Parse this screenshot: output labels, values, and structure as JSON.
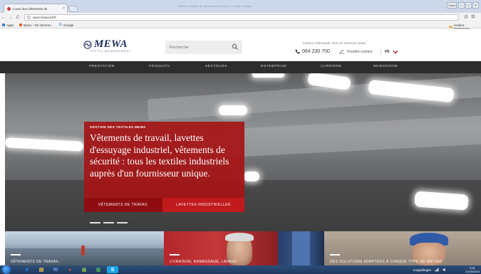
{
  "browser": {
    "tab_title": "Louer des vêtements de",
    "tab_close": "×",
    "window_title": "MEWA Location de vêtements de travail - Google Chrome",
    "user_button": "Coba",
    "controls": [
      "–",
      "□",
      "×"
    ],
    "back": "←",
    "forward": "→",
    "reload": "C",
    "url": "www.mewa.be/fr",
    "bookmarks": [
      {
        "label": "Apps",
        "color": "#3b7bd9"
      },
      {
        "label": "Bienv - De interess...",
        "color": "#e2612c"
      },
      {
        "label": "Google",
        "color": "#4285f4"
      }
    ],
    "bookmark_folder": "Andere bladwijzers"
  },
  "header": {
    "logo_text": "MEWA",
    "logo_tagline": "TEXTIL-MANAGEMENT",
    "search_placeholder": "Recherche",
    "contact_title": "CONSEIL PERSONNEL SUR LES SERVICES MEWA",
    "phone": "064 230 700",
    "contact_link": "Prendre contact",
    "language": "FR"
  },
  "nav": {
    "items": [
      "PRESTATION",
      "PRODUITS",
      "SECTEURS",
      "ENTREPRISE",
      "CARRIÈRE",
      "NEWSROOM"
    ]
  },
  "hero": {
    "kicker": "GESTION DES TEXTILES MEWA",
    "title": "Vêtements de travail, lavettes d'essuyage industriel, vêtements de sécurité : tous les textiles industriels auprès d'un fournisseur unique.",
    "button_workwear": "VÊTEMENTS DE TRAVAIL",
    "button_wipes": "LAVETTES INDUSTRIELLES",
    "slide_count": 3
  },
  "teasers": [
    {
      "label": "VÊTEMENTS DE TRAVAIL"
    },
    {
      "label": "LIVRAISON, RAMASSAGE, LAVAGE"
    },
    {
      "label": ""
    },
    {
      "label": "DES SOLUTIONS ADAPTÉES À CHAQUE TYPE DE MÉTIER"
    }
  ],
  "taskbar": {
    "apps": [
      {
        "glyph": "e",
        "color": "#1e90ff"
      },
      {
        "glyph": "▤",
        "color": "#f0c040"
      },
      {
        "glyph": "W",
        "color": "#3b6fc9"
      },
      {
        "glyph": "●",
        "color": "#e24a2b"
      },
      {
        "glyph": "▣",
        "color": "#7fb24b"
      },
      {
        "glyph": "▦",
        "color": "#4aa45c"
      },
      {
        "glyph": "S",
        "color": "#1aa3e8"
      }
    ],
    "tray_label": "Koppelingen",
    "clock_time": "9:51",
    "clock_date": "21/05/2019"
  },
  "colors": {
    "brand_navy": "#1b2c5f",
    "brand_red": "#a61416",
    "nav_bg": "#2d2d2d"
  }
}
